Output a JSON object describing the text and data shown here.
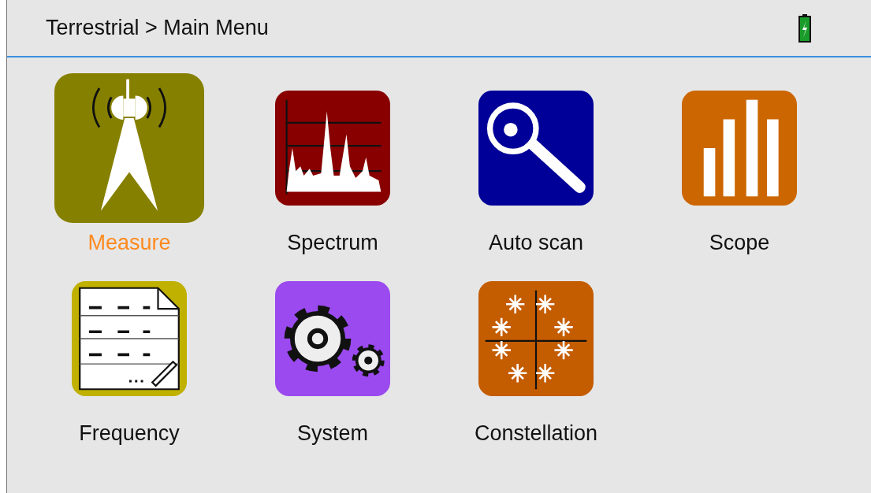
{
  "header": {
    "breadcrumb": "Terrestrial > Main Menu"
  },
  "menu": [
    {
      "label": "Measure",
      "kind": "measure",
      "color": "#868000",
      "selected": true
    },
    {
      "label": "Spectrum",
      "kind": "spectrum",
      "color": "#880000",
      "selected": false
    },
    {
      "label": "Auto scan",
      "kind": "autoscan",
      "color": "#000099",
      "selected": false
    },
    {
      "label": "Scope",
      "kind": "scope",
      "color": "#cc6600",
      "selected": false
    },
    {
      "label": "Frequency",
      "kind": "frequency",
      "color": "#c0b000",
      "selected": false
    },
    {
      "label": "System",
      "kind": "system",
      "color": "#9b4aef",
      "selected": false
    },
    {
      "label": "Constellation",
      "kind": "constellation",
      "color": "#c45c00",
      "selected": false
    }
  ]
}
